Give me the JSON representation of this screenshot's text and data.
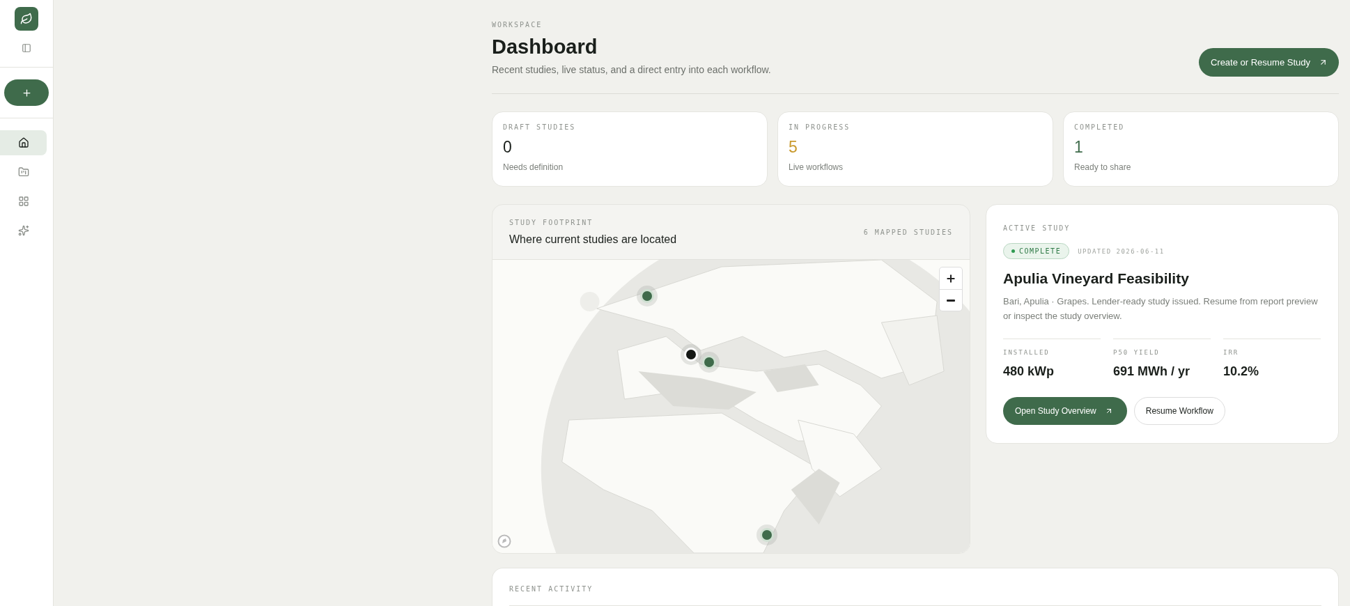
{
  "sidebar": {
    "nav": [
      {
        "kind": "home",
        "selected": true
      },
      {
        "kind": "folder",
        "selected": false
      },
      {
        "kind": "grid",
        "selected": false
      },
      {
        "kind": "sparkles",
        "selected": false
      }
    ]
  },
  "header": {
    "eyebrow": "WORKSPACE",
    "title": "Dashboard",
    "subtitle": "Recent studies, live status, and a direct entry into each workflow.",
    "action": "Create or Resume Study"
  },
  "stats": [
    {
      "label": "DRAFT STUDIES",
      "value": "0",
      "note": "Needs definition",
      "color": "#1a1f1b"
    },
    {
      "label": "IN PROGRESS",
      "value": "5",
      "note": "Live workflows",
      "color": "#c99a2e"
    },
    {
      "label": "COMPLETED",
      "value": "1",
      "note": "Ready to share",
      "color": "#3f6b4b"
    }
  ],
  "map": {
    "eyebrow": "STUDY FOOTPRINT",
    "title": "Where current studies are located",
    "count": "6 MAPPED STUDIES",
    "kind": "picture",
    "markers": [
      {
        "selected": false
      },
      {
        "selected": true
      },
      {
        "selected": false
      },
      {
        "selected": false
      }
    ]
  },
  "active_study": {
    "eyebrow": "ACTIVE STUDY",
    "status": "COMPLETE",
    "updated": "UPDATED 2026-06-11",
    "title": "Apulia Vineyard Feasibility",
    "description": "Bari, Apulia · Grapes. Lender-ready study issued. Resume from report preview or inspect the study overview.",
    "metrics": [
      {
        "label": "INSTALLED",
        "value": "480 kWp"
      },
      {
        "label": "P50 YIELD",
        "value": "691 MWh / yr"
      },
      {
        "label": "IRR",
        "value": "10.2%"
      }
    ],
    "primary": "Open Study Overview",
    "secondary": "Resume Workflow"
  },
  "recent": {
    "eyebrow": "RECENT ACTIVITY"
  }
}
